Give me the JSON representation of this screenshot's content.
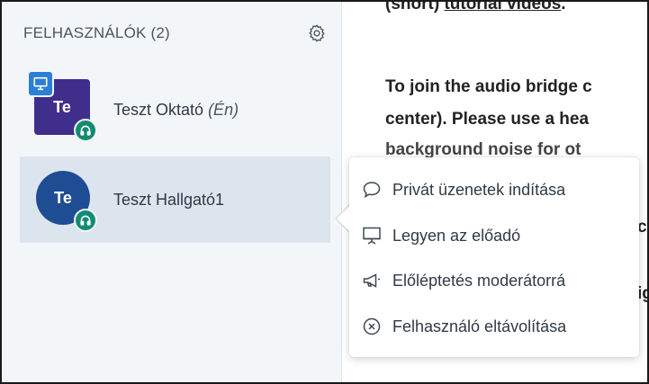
{
  "sidebar": {
    "title": "FELHASZNÁLÓK (2)",
    "users": [
      {
        "initials": "Te",
        "name": "Teszt Oktató",
        "self_tag": "(Én)"
      },
      {
        "initials": "Te",
        "name": "Teszt Hallgató1"
      }
    ]
  },
  "content": {
    "line1_a": "(short) ",
    "line1_b": "tutorial videos",
    "line1_c": ".",
    "line2": "To join the audio bridge c",
    "line3_a": "center). ",
    "line3_b": "Please use a hea",
    "line4": "background noise for ot",
    "line5": "c",
    "line6": "ig"
  },
  "menu": {
    "items": [
      {
        "label": "Privát üzenetek indítása",
        "icon": "chat-bubble-icon"
      },
      {
        "label": "Legyen az előadó",
        "icon": "presentation-icon"
      },
      {
        "label": "Előléptetés moderátorrá",
        "icon": "megaphone-icon"
      },
      {
        "label": "Felhasználó eltávolítása",
        "icon": "remove-circle-icon"
      }
    ]
  },
  "colors": {
    "sidebar_bg": "#f3f6f9",
    "selected_row": "#dce4ee",
    "avatar_teacher": "#3f2e8c",
    "avatar_student": "#1f4d93",
    "audio_badge": "#138b73",
    "presenter_badge": "#2a7fd6"
  }
}
